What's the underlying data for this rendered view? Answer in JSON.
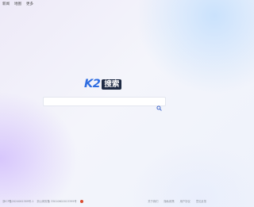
{
  "topnav": {
    "items": [
      {
        "label": "新闻"
      },
      {
        "label": "地图"
      },
      {
        "label": "更多"
      }
    ]
  },
  "logo": {
    "brand": "K2",
    "text": "搜索"
  },
  "search": {
    "value": "",
    "placeholder": ""
  },
  "footer": {
    "icp": "浙ICP备2024061389号-1",
    "police": "浙公网安备 33010602013399号",
    "links": [
      {
        "label": "关于我们"
      },
      {
        "label": "隐私政策"
      },
      {
        "label": "用户协议"
      },
      {
        "label": "意见反馈"
      }
    ]
  },
  "colors": {
    "brand_blue": "#2f6de0",
    "brand_dark": "#1f2b44",
    "search_icon": "#3b63c9"
  }
}
